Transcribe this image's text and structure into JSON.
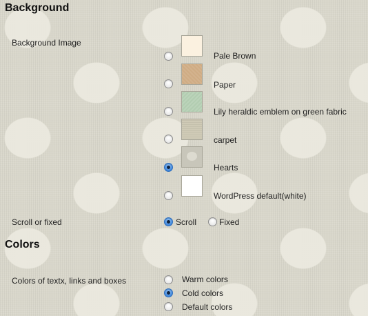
{
  "background_section": {
    "heading": "Background",
    "image_label": "Background Image",
    "options": [
      {
        "label": "Pale Brown",
        "selected": false
      },
      {
        "label": "Paper",
        "selected": false
      },
      {
        "label": "Lily heraldic emblem on green fabric",
        "selected": false
      },
      {
        "label": "carpet",
        "selected": false
      },
      {
        "label": "Hearts",
        "selected": true
      },
      {
        "label": "WordPress default(white)",
        "selected": false
      }
    ],
    "scroll_label": "Scroll or fixed",
    "scroll_options": [
      {
        "label": "Scroll",
        "selected": true
      },
      {
        "label": "Fixed",
        "selected": false
      }
    ]
  },
  "colors_section": {
    "heading": "Colors",
    "label": "Colors of textx, links and boxes",
    "options": [
      {
        "label": "Warm colors",
        "selected": false
      },
      {
        "label": "Cold colors",
        "selected": true
      },
      {
        "label": "Default colors",
        "selected": false
      }
    ]
  },
  "colors": {
    "swatch_pale_brown": "#fbf1e0",
    "swatch_paper": "#cfac84",
    "swatch_lily": "#b2cdb1",
    "swatch_carpet": "#cfcab6",
    "swatch_hearts": "#c8c6ba",
    "swatch_white": "#ffffff",
    "radio_checked": "#4a90e2"
  }
}
